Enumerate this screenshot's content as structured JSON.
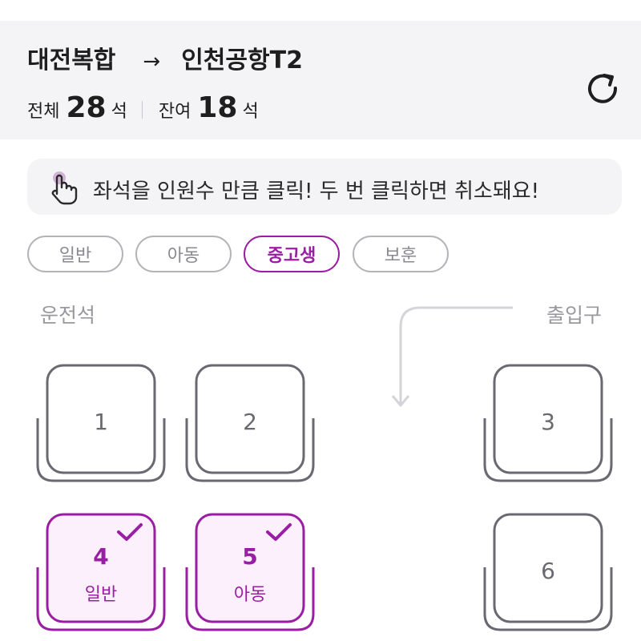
{
  "header": {
    "origin": "대전복합",
    "arrow": "→",
    "destination": "인천공항T2",
    "total_label": "전체",
    "total_count": "28",
    "total_unit": "석",
    "remaining_label": "잔여",
    "remaining_count": "18",
    "remaining_unit": "석",
    "refresh_icon": "refresh-icon"
  },
  "notice": {
    "icon": "tap-hand-icon",
    "text": "좌석을 인원수 만큼 클릭! 두 번 클릭하면 취소돼요!"
  },
  "tabs": [
    {
      "label": "일반",
      "active": false
    },
    {
      "label": "아동",
      "active": false
    },
    {
      "label": "중고생",
      "active": true
    },
    {
      "label": "보훈",
      "active": false
    }
  ],
  "layout_labels": {
    "driver": "운전석",
    "entrance": "출입구"
  },
  "seats": [
    {
      "number": "1",
      "selected": false,
      "type": ""
    },
    {
      "number": "2",
      "selected": false,
      "type": ""
    },
    {
      "number": "3",
      "selected": false,
      "type": ""
    },
    {
      "number": "4",
      "selected": true,
      "type": "일반"
    },
    {
      "number": "5",
      "selected": true,
      "type": "아동"
    },
    {
      "number": "6",
      "selected": false,
      "type": ""
    }
  ],
  "colors": {
    "accent": "#9a1ea3",
    "seat_border": "#6a6870",
    "selected_fill": "#fbf0fb",
    "header_bg": "#f4f3f6"
  }
}
